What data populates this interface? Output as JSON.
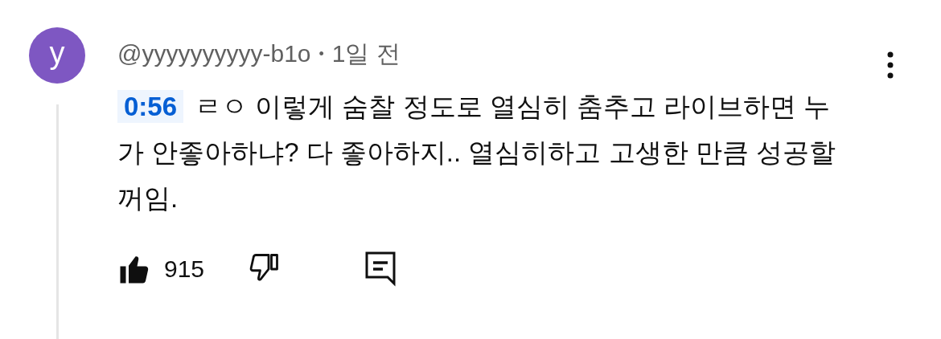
{
  "comment": {
    "avatar_letter": "y",
    "author": "@yyyyyyyyyy-b1o",
    "separator": "•",
    "time": "1일 전",
    "timestamp": "0:56",
    "text": "ㄹㅇ 이렇게 숨찰 정도로 열심히 춤추고 라이브하면 누가 안좋아하냐? 다 좋아하지.. 열심히하고 고생한 만큼 성공할꺼임.",
    "likes": "915",
    "liked": true,
    "disliked": false
  }
}
